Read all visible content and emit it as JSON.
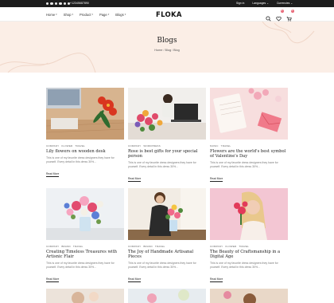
{
  "topbar": {
    "social_icons": [
      "facebook-icon",
      "twitter-icon",
      "pinterest-icon",
      "instagram-icon",
      "youtube-icon",
      "location-icon"
    ],
    "phone": "+12345687890",
    "sign_in": "Sign in",
    "language": "Languages ⌄",
    "currency": "Currencies ⌄"
  },
  "header": {
    "nav": [
      {
        "label": "Home"
      },
      {
        "label": "Shop"
      },
      {
        "label": "Product"
      },
      {
        "label": "Page"
      },
      {
        "label": "Blogs"
      }
    ],
    "logo": "FLOKA",
    "wishlist_count": "0",
    "cart_count": "0"
  },
  "hero": {
    "title": "Blogs",
    "breadcrumb": [
      "Home",
      "Blog",
      "Blog"
    ]
  },
  "posts": [
    {
      "cats": [
        "COMPANY",
        "FLOWER",
        "TRAVEL"
      ],
      "title": "Lily flowers on wooden desk",
      "excerpt": "This is one of my favorite dress designers they have for yourself. Every detail in this dress 30%...",
      "more": "Read More"
    },
    {
      "cats": [
        "COMPANY",
        "WORDPRESS"
      ],
      "title": "Rose is best gifts for your special person",
      "excerpt": "This is one of my favorite dress designers they have for yourself. Every detail in this dress 30%...",
      "more": "Read More"
    },
    {
      "cats": [
        "MUSIC",
        "TRAVEL"
      ],
      "title": "Flowers are the world's best symbol of Valentine's Day",
      "excerpt": "This is one of my favorite dress designers they have for yourself. Every detail in this dress 30%...",
      "more": "Read More"
    },
    {
      "cats": [
        "COMPANY",
        "BRAND",
        "TRAVEL"
      ],
      "title": "Creating Timeless Treasures with Artisnic Flair",
      "excerpt": "This is one of my favorite dress designers they have for yourself. Every detail in this dress 30%...",
      "more": "Read More"
    },
    {
      "cats": [
        "COMPANY",
        "BRAND",
        "TRAVEL"
      ],
      "title": "The Joy of Handmade Artisanal Pieces",
      "excerpt": "This is one of my favorite dress designers they have for yourself. Every detail in this dress 30%...",
      "more": "Read More"
    },
    {
      "cats": [
        "COMPANY",
        "FLOWER",
        "TRAVEL"
      ],
      "title": "The Beauty of Craftsmanship in a Digital Age",
      "excerpt": "This is one of my favorite dress designers they have for yourself. Every detail in this dress 30%...",
      "more": "Read More"
    }
  ],
  "colors": {
    "topbar_bg": "#1d1d1d",
    "hero_bg": "#fbeee6",
    "badge": "#e86a7a"
  }
}
